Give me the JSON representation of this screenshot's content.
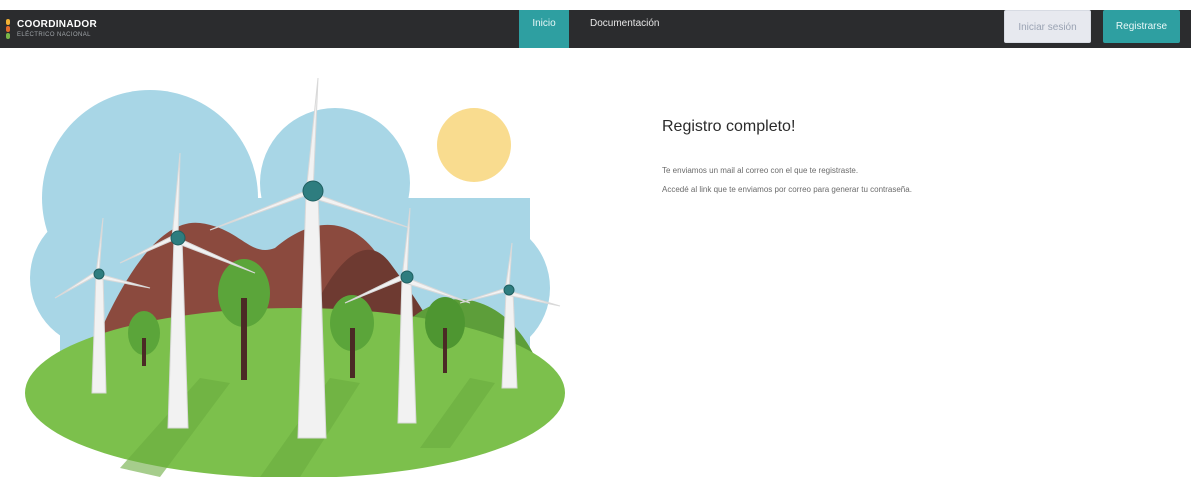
{
  "brand": {
    "title": "COORDINADOR",
    "subtitle": "ELÉCTRICO NACIONAL",
    "colors": [
      "#f2b134",
      "#e36b2c",
      "#7ab648"
    ]
  },
  "nav": {
    "items": [
      {
        "label": "Inicio",
        "active": true
      },
      {
        "label": "Documentación",
        "active": false
      }
    ]
  },
  "auth": {
    "login_label": "Iniciar sesión",
    "register_label": "Registrarse"
  },
  "main": {
    "title": "Registro completo!",
    "lines": [
      "Te enviamos un mail al correo con el que te registraste.",
      "Accedé al link que te enviamos por correo para generar tu contraseña."
    ]
  },
  "illustration": {
    "subject": "wind-turbines-landscape",
    "colors": {
      "sky": "#a8d6e6",
      "sun": "#f9dc8f",
      "hill": "#8b4a3e",
      "grass": "#7cc04c",
      "accent": "#2e9fa1"
    }
  },
  "theme": {
    "navbar_bg": "#2b2c2e",
    "accent": "#2e9fa1"
  }
}
